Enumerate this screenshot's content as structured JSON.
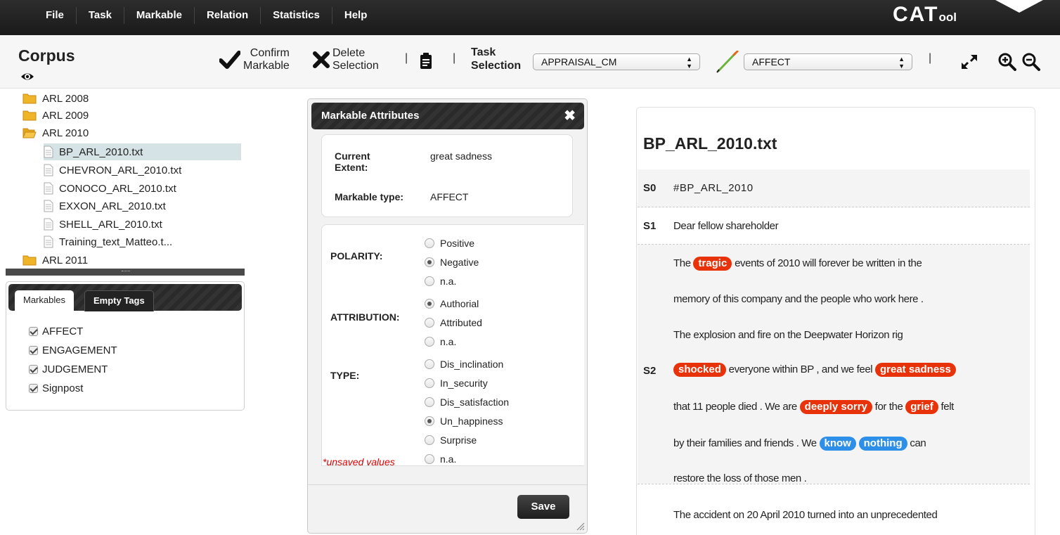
{
  "menu": {
    "items": [
      "File",
      "Task",
      "Markable",
      "Relation",
      "Statistics",
      "Help"
    ],
    "logo_big": "CAT",
    "logo_small": "ool"
  },
  "toolbar": {
    "corpus_title": "Corpus",
    "confirm_line1": "Confirm",
    "confirm_line2": "Markable",
    "delete_line1": "Delete",
    "delete_line2": "Selection",
    "task_line1": "Task",
    "task_line2": "Selection",
    "task_select_value": "APPRAISAL_CM",
    "markable_select_value": "AFFECT",
    "separator": "|"
  },
  "tree": {
    "folders": [
      "ARL 2008",
      "ARL 2009",
      "ARL 2010",
      "ARL 2011"
    ],
    "files": [
      "BP_ARL_2010.txt",
      "CHEVRON_ARL_2010.txt",
      "CONOCO_ARL_2010.txt",
      "EXXON_ARL_2010.txt",
      "SHELL_ARL_2010.txt",
      "Training_text_Matteo.t..."
    ]
  },
  "tags": {
    "tab_markables": "Markables",
    "tab_empty": "Empty Tags",
    "items": [
      "AFFECT",
      "ENGAGEMENT",
      "JUDGEMENT",
      "Signpost"
    ]
  },
  "dialog": {
    "title": "Markable Attributes",
    "close": "✖",
    "current_extent_label1": "Current",
    "current_extent_label2": "Extent:",
    "current_extent_value": "great sadness",
    "markable_type_label": "Markable type:",
    "markable_type_value": "AFFECT",
    "polarity_label": "POLARITY:",
    "polarity_options": [
      "Positive",
      "Negative",
      "n.a."
    ],
    "polarity_selected": "Negative",
    "attribution_label": "ATTRIBUTION:",
    "attribution_options": [
      "Authorial",
      "Attributed",
      "n.a."
    ],
    "attribution_selected": "Authorial",
    "type_label": "TYPE:",
    "type_options": [
      "Dis_inclination",
      "In_security",
      "Dis_satisfaction",
      "Un_happiness",
      "Surprise",
      "n.a."
    ],
    "type_selected": "Un_happiness",
    "unsaved": "*unsaved values",
    "save": "Save"
  },
  "document": {
    "title": "BP_ARL_2010.txt",
    "s0_label": "S0",
    "s0_text": "#BP_ARL_2010",
    "s1_label": "S1",
    "s1_text": "Dear fellow shareholder",
    "s2_label": "S2",
    "p1_a": "The",
    "p1_hl": "tragic",
    "p1_b": "events of 2010 will forever be written in the",
    "p2": "memory of this company and the people who work here .",
    "p3": "The explosion and fire on the Deepwater Horizon rig",
    "s2_hl1": "shocked",
    "s2_a": "everyone within BP , and we feel",
    "s2_hl2": "great sadness",
    "s3_a": "that 11 people died . We are",
    "s3_hl1": "deeply sorry",
    "s3_b": "for the",
    "s3_hl2": "grief",
    "s3_c": "felt",
    "s4_a": "by their families and friends . We",
    "s4_hl1": "know",
    "s4_hl2": "nothing",
    "s4_b": "can",
    "s5": "restore the loss of those men .",
    "s6": "The accident on 20 April 2010 turned into an unprecedented"
  },
  "colors": {
    "highlight_negative": "#e8320a",
    "highlight_engagement": "#2d8fe8",
    "folder": "#f0b429"
  }
}
